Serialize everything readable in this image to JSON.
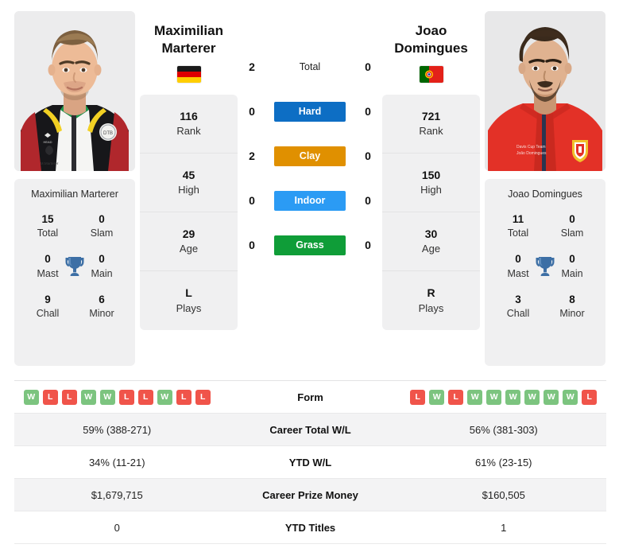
{
  "players": {
    "left": {
      "name_line1": "Maximilian",
      "name_line2": "Marterer",
      "full_name": "Maximilian Marterer",
      "country": "Germany",
      "flag_icon": "flag-germany",
      "rank": "116",
      "rank_label": "Rank",
      "high": "45",
      "high_label": "High",
      "age": "29",
      "age_label": "Age",
      "plays": "L",
      "plays_label": "Plays",
      "titles": {
        "total": "15",
        "total_label": "Total",
        "slam": "0",
        "slam_label": "Slam",
        "mast": "0",
        "mast_label": "Mast",
        "main": "0",
        "main_label": "Main",
        "chall": "9",
        "chall_label": "Chall",
        "minor": "6",
        "minor_label": "Minor"
      },
      "form": [
        "W",
        "L",
        "L",
        "W",
        "W",
        "L",
        "L",
        "W",
        "L",
        "L"
      ],
      "career_wl": "59% (388-271)",
      "ytd_wl": "34% (11-21)",
      "prize_money": "$1,679,715",
      "ytd_titles": "0"
    },
    "right": {
      "name_line1": "Joao",
      "name_line2": "Domingues",
      "full_name": "Joao Domingues",
      "country": "Portugal",
      "flag_icon": "flag-portugal",
      "rank": "721",
      "rank_label": "Rank",
      "high": "150",
      "high_label": "High",
      "age": "30",
      "age_label": "Age",
      "plays": "R",
      "plays_label": "Plays",
      "titles": {
        "total": "11",
        "total_label": "Total",
        "slam": "0",
        "slam_label": "Slam",
        "mast": "0",
        "mast_label": "Mast",
        "main": "0",
        "main_label": "Main",
        "chall": "3",
        "chall_label": "Chall",
        "minor": "8",
        "minor_label": "Minor"
      },
      "form": [
        "L",
        "W",
        "L",
        "W",
        "W",
        "W",
        "W",
        "W",
        "W",
        "L"
      ],
      "career_wl": "56% (381-303)",
      "ytd_wl": "61% (23-15)",
      "prize_money": "$160,505",
      "ytd_titles": "1"
    }
  },
  "head_to_head": [
    {
      "label": "Total",
      "left": "2",
      "right": "0",
      "pill": false,
      "color": ""
    },
    {
      "label": "Hard",
      "left": "0",
      "right": "0",
      "pill": true,
      "color": "#0d6ec4"
    },
    {
      "label": "Clay",
      "left": "2",
      "right": "0",
      "pill": true,
      "color": "#e09000"
    },
    {
      "label": "Indoor",
      "left": "0",
      "right": "0",
      "pill": true,
      "color": "#2b9bf4"
    },
    {
      "label": "Grass",
      "left": "0",
      "right": "0",
      "pill": true,
      "color": "#0f9d38"
    }
  ],
  "stats_table": {
    "rows": [
      {
        "label": "Form",
        "type": "form",
        "left": "",
        "right": "",
        "alt": false
      },
      {
        "label": "Career Total W/L",
        "type": "text",
        "left": "59% (388-271)",
        "right": "56% (381-303)",
        "alt": true
      },
      {
        "label": "YTD W/L",
        "type": "text",
        "left": "34% (11-21)",
        "right": "61% (23-15)",
        "alt": false
      },
      {
        "label": "Career Prize Money",
        "type": "text",
        "left": "$1,679,715",
        "right": "$160,505",
        "alt": true
      },
      {
        "label": "YTD Titles",
        "type": "text",
        "left": "0",
        "right": "1",
        "alt": false
      }
    ]
  },
  "colors": {
    "hard": "#0d6ec4",
    "clay": "#e09000",
    "indoor": "#2b9bf4",
    "grass": "#0f9d38",
    "win": "#7cc47f",
    "loss": "#f0544a",
    "trophy": "#3d6fa5",
    "card_bg": "#f0f0f1"
  }
}
